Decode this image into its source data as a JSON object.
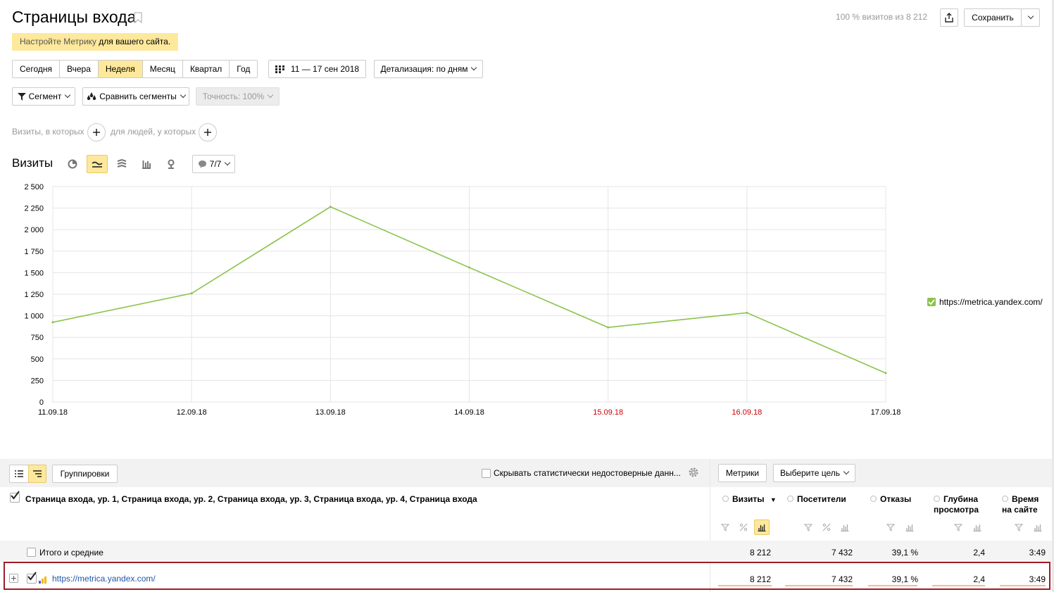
{
  "header": {
    "title": "Страницы входа",
    "visits_summary": "100 % визитов из 8 212",
    "save_label": "Сохранить"
  },
  "notice": {
    "link_text": "Настройте Метрику",
    "rest_text": " для вашего сайта."
  },
  "periods": [
    "Сегодня",
    "Вчера",
    "Неделя",
    "Месяц",
    "Квартал",
    "Год"
  ],
  "selected_period": "Неделя",
  "date_range": "11 — 17 сен 2018",
  "detail": "Детализация: по дням",
  "segment_label": "Сегмент",
  "compare_label": "Сравнить сегменты",
  "accuracy_label": "Точность: 100%",
  "filters": {
    "visits_label": "Визиты, в которых",
    "people_label": "для людей, у которых"
  },
  "chart_section": {
    "title": "Визиты",
    "annotations": "7/7"
  },
  "chart_data": {
    "type": "line",
    "x": [
      "11.09.18",
      "12.09.18",
      "13.09.18",
      "14.09.18",
      "15.09.18",
      "16.09.18",
      "17.09.18"
    ],
    "weekend_x": [
      "15.09.18",
      "16.09.18"
    ],
    "series": [
      {
        "name": "https://metrica.yandex.com/",
        "values": [
          925,
          1260,
          2265,
          1560,
          865,
          1035,
          335
        ],
        "color": "#8bc34a"
      }
    ],
    "yticks": [
      "2 500",
      "2 250",
      "2 000",
      "1 750",
      "1 500",
      "1 250",
      "1 000",
      "750",
      "500",
      "250",
      "0"
    ],
    "ylim": [
      0,
      2500
    ],
    "grid": true,
    "legend": "right"
  },
  "table": {
    "groupings_label": "Группировки",
    "hide_stat_label": "Скрывать статистически недостоверные данн...",
    "metrics_label": "Метрики",
    "goal_label": "Выберите цель",
    "dimension_header": "Страница входа, ур. 1, Страница входа, ур. 2, Страница входа, ур. 3, Страница входа, ур. 4, Страница входа",
    "columns": [
      {
        "label": "Визиты",
        "sort": "▼"
      },
      {
        "label": "Посетители"
      },
      {
        "label": "Отказы"
      },
      {
        "label": "Глубина просмотра"
      },
      {
        "label": "Время на сайте"
      }
    ],
    "totals_label": "Итого и средние",
    "totals": [
      "8 212",
      "7 432",
      "39,1 %",
      "2,4",
      "3:49"
    ],
    "rows": [
      {
        "label": "https://metrica.yandex.com/",
        "values": [
          "8 212",
          "7 432",
          "39,1 %",
          "2,4",
          "3:49"
        ]
      }
    ]
  }
}
